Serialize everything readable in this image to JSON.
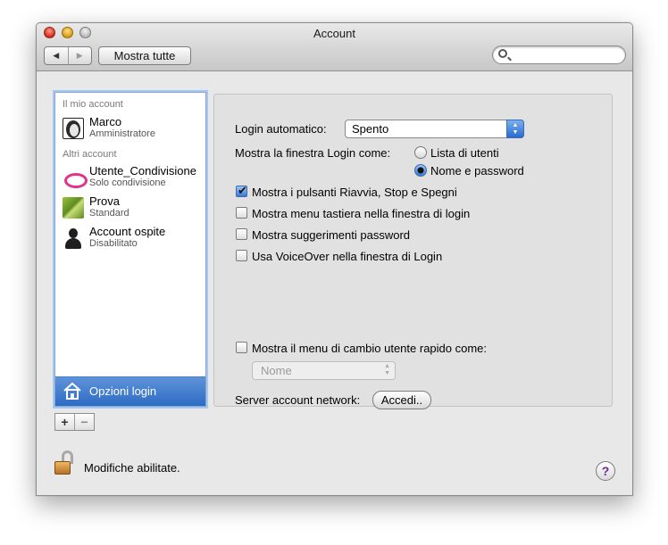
{
  "window": {
    "title": "Account"
  },
  "toolbar": {
    "back_icon": "◀",
    "forward_icon": "▶",
    "show_all_label": "Mostra tutte",
    "search_value": ""
  },
  "sidebar": {
    "my_account_header": "Il mio account",
    "my_account": {
      "name": "Marco",
      "role": "Amministratore"
    },
    "other_accounts_header": "Altri account",
    "other_accounts": [
      {
        "name": "Utente_Condivisione",
        "role": "Solo condivisione"
      },
      {
        "name": "Prova",
        "role": "Standard"
      },
      {
        "name": "Account ospite",
        "role": "Disabilitato"
      }
    ],
    "login_options_label": "Opzioni login",
    "add_label": "+",
    "remove_label": "−"
  },
  "panel": {
    "auto_login_label": "Login automatico:",
    "auto_login_value": "Spento",
    "display_login_label": "Mostra la finestra Login come:",
    "radio_list_label": "Lista di utenti",
    "radio_name_label": "Nome e password",
    "radio_selected": "Nome e password",
    "check_restart_label": "Mostra i pulsanti Riavvia, Stop e Spegni",
    "check_restart": true,
    "check_input_menu_label": "Mostra menu tastiera nella finestra di login",
    "check_input_menu": false,
    "check_hints_label": "Mostra suggerimenti password",
    "check_hints": false,
    "check_voiceover_label": "Usa VoiceOver nella finestra di Login",
    "check_voiceover": false,
    "check_fast_switch_label": "Mostra il menu di cambio utente rapido come:",
    "check_fast_switch": false,
    "fast_switch_value": "Nome",
    "network_server_label": "Server account network:",
    "join_button_label": "Accedi.."
  },
  "footer": {
    "status_text": "Modifiche abilitate.",
    "help_label": "?"
  },
  "colors": {
    "selection_blue": "#2e6cc4",
    "help_purple": "#6a2a8a"
  }
}
